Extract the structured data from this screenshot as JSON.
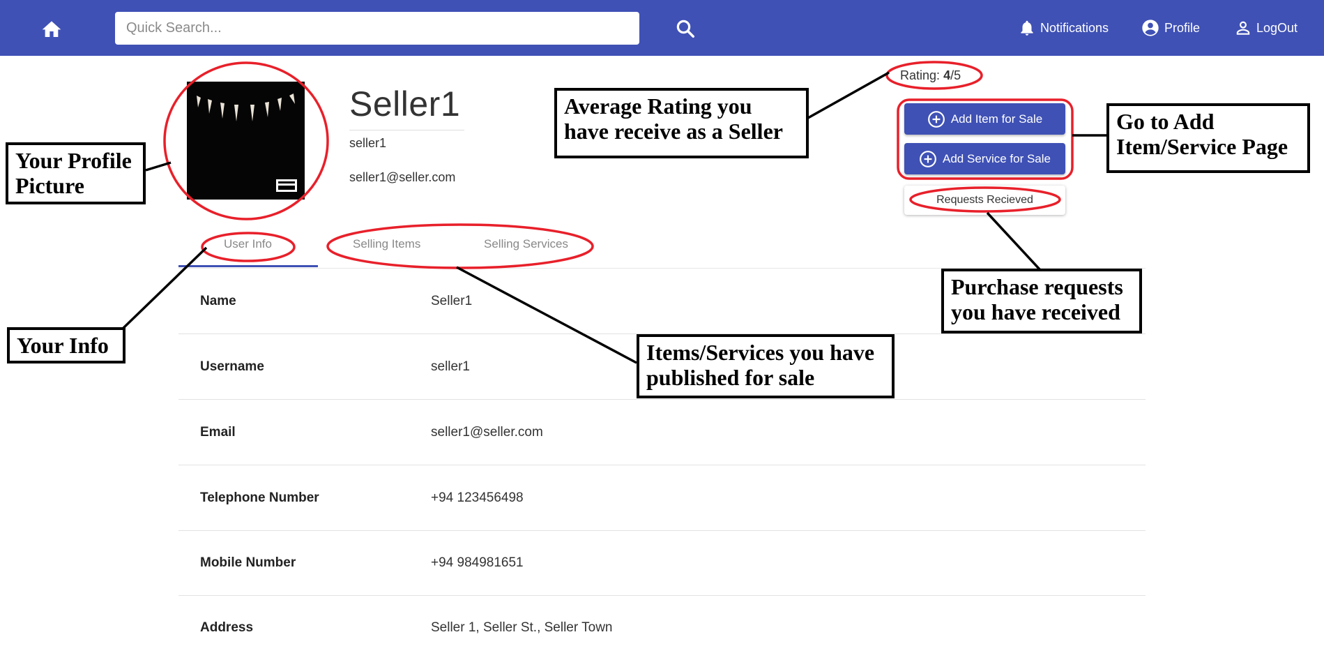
{
  "appbar": {
    "search_placeholder": "Quick Search...",
    "nav": {
      "notifications": "Notifications",
      "profile": "Profile",
      "logout": "LogOut"
    }
  },
  "profile": {
    "display_name": "Seller1",
    "username": "seller1",
    "email": "seller1@seller.com",
    "rating_label": "Rating:",
    "rating_value": "4",
    "rating_max": "/5",
    "add_item_label": "Add Item for Sale",
    "add_service_label": "Add Service for Sale",
    "requests_label": "Requests Recieved"
  },
  "tabs": [
    "User Info",
    "Selling Items",
    "Selling Services"
  ],
  "info_rows": [
    {
      "label": "Name",
      "value": "Seller1"
    },
    {
      "label": "Username",
      "value": "seller1"
    },
    {
      "label": "Email",
      "value": "seller1@seller.com"
    },
    {
      "label": "Telephone Number",
      "value": "+94 123456498"
    },
    {
      "label": "Mobile Number",
      "value": "+94 984981651"
    },
    {
      "label": "Address",
      "value": "Seller 1, Seller St., Seller Town"
    }
  ],
  "annotations": {
    "profile_picture": "Your Profile Picture",
    "rating": "Average Rating you have receive as a Seller",
    "add_page": "Go to Add Item/Service Page",
    "requests": "Purchase requests you have received",
    "info": "Your Info",
    "selling": "Items/Services you have published for sale"
  },
  "colors": {
    "appbar": "#3f51b5",
    "primary_button": "#3f51b5",
    "annotation_ring": "#e8202a"
  }
}
